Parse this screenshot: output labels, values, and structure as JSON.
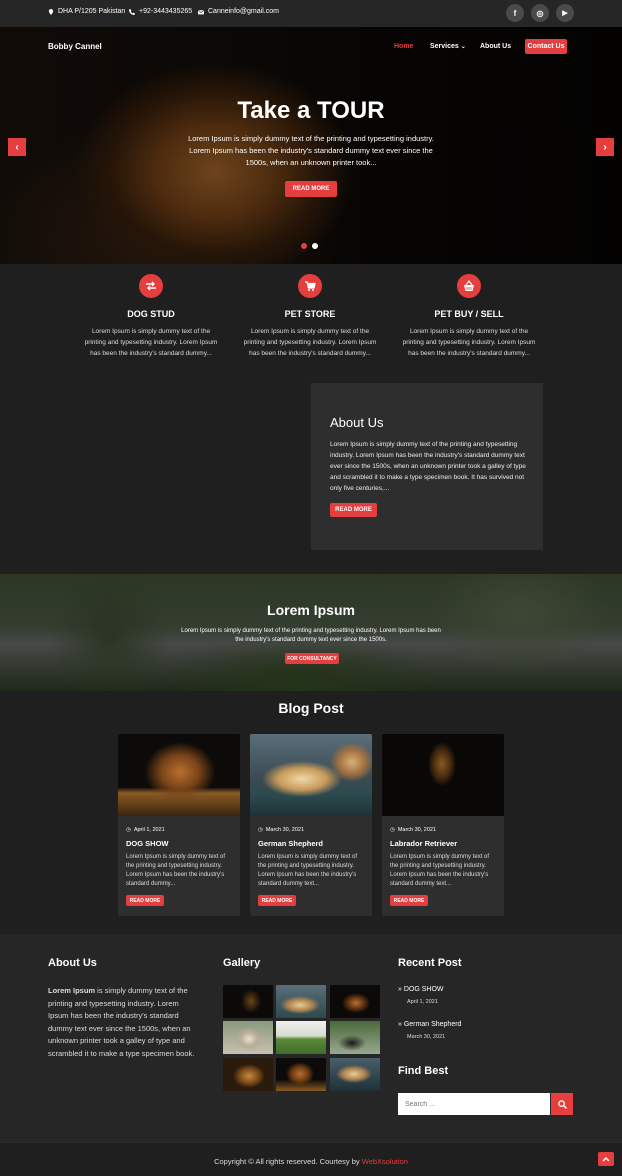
{
  "topbar": {
    "address": "DHA P/1205 Pakistan",
    "phone": "+92-3443435265",
    "email": "Canneinfo@gmail.com",
    "social": [
      {
        "icon": "facebook-icon",
        "glyph": "f"
      },
      {
        "icon": "instagram-icon",
        "glyph": "◎"
      },
      {
        "icon": "youtube-icon",
        "glyph": "▶"
      }
    ]
  },
  "header": {
    "brand": "Bobby Cannel",
    "nav": {
      "home": "Home",
      "services": "Services",
      "about": "About Us",
      "contact": "Contact Us"
    },
    "accent": "#e53e3e"
  },
  "hero": {
    "title": "Take a TOUR",
    "text": "Lorem Ipsum is simply dummy text of the printing and typesetting industry. Lorem Ipsum has been the industry's standard dummy text ever since the 1500s, when an unknown printer took...",
    "button": "READ MORE",
    "prev": "‹",
    "next": "›"
  },
  "services": [
    {
      "title": "DOG STUD",
      "icon": "swap-arrows-icon",
      "text": "Lorem Ipsum is simply dummy text of the printing and typesetting industry. Lorem Ipsum has been the industry's standard dummy..."
    },
    {
      "title": "PET STORE",
      "icon": "shopping-cart-icon",
      "text": "Lorem Ipsum is simply dummy text of the printing and typesetting industry. Lorem Ipsum has been the industry's standard dummy..."
    },
    {
      "title": "PET BUY / SELL",
      "icon": "basket-icon",
      "text": "Lorem Ipsum is simply dummy text of the printing and typesetting industry. Lorem Ipsum has been the industry's standard dummy..."
    }
  ],
  "about": {
    "title": "About Us",
    "text": "Lorem Ipsum is simply dummy text of the printing and typesetting industry. Lorem Ipsum has been the industry's standard dummy text ever since the 1500s, when an unknown printer took a galley of type and scrambled it to make a type specimen book. It has survived not only five centuries,...",
    "button": "READ MORE"
  },
  "consult": {
    "title": "Lorem Ipsum",
    "text": "Lorem Ipsum is simply dummy text of the printing and typesetting industry. Lorem Ipsum has been the industry's standard dummy text ever since the 1500s.",
    "button": "FOR CONSULTANCY"
  },
  "blog": {
    "title": "Blog Post",
    "posts": [
      {
        "date": "April 1, 2021",
        "title": "DOG SHOW",
        "text": "Lorem Ipsum is simply dummy text of the printing and typesetting industry. Lorem Ipsum has been the industry's standard dummy...",
        "button": "READ MORE"
      },
      {
        "date": "March 30, 2021",
        "title": "German Shepherd",
        "text": "Lorem Ipsum is simply dummy text of the printing and typesetting industry. Lorem Ipsum has been the industry's standard dummy text...",
        "button": "READ MORE"
      },
      {
        "date": "March 30, 2021",
        "title": "Labrador Retriever",
        "text": "Lorem Ipsum is simply dummy text of the printing and typesetting industry. Lorem Ipsum has been the industry's standard dummy text...",
        "button": "READ MORE"
      }
    ]
  },
  "footer": {
    "about_title": "About Us",
    "about_bold": "Lorem Ipsum",
    "about_text": " is simply dummy text of the printing and typesetting industry. Lorem Ipsum has been the industry's standard dummy text ever since the 1500s, when an unknown printer took a galley of type and scrambled it to make a type specimen book.",
    "gallery_title": "Gallery",
    "recent_title": "Recent Post",
    "recent": [
      {
        "title": "DOG SHOW",
        "date": "April 1, 2021"
      },
      {
        "title": "German Shepherd",
        "date": "March 30, 2021"
      }
    ],
    "find_title": "Find Best",
    "search_placeholder": "Search ..."
  },
  "copyright": {
    "text": "Copyright © All rights reserved. Courtesy by ",
    "brand": "WebXsolution"
  }
}
